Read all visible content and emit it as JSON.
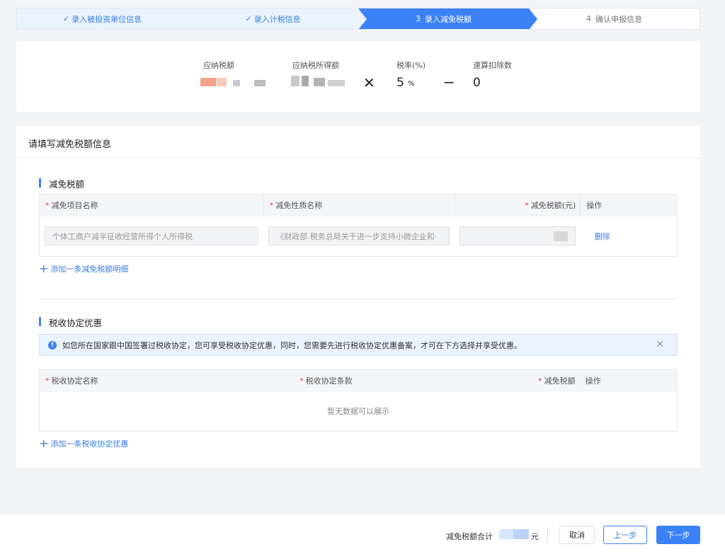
{
  "steps": [
    {
      "label": "录入被投资单位信息",
      "state": "done",
      "check": "✓"
    },
    {
      "label": "录入计税信息",
      "state": "done",
      "check": "✓"
    },
    {
      "num": "3",
      "label": "录入减免税额",
      "state": "active"
    },
    {
      "num": "4",
      "label": "确认申报信息",
      "state": "todo"
    }
  ],
  "formula": {
    "tax_payable_label": "应纳税额",
    "taxable_income_label": "应纳税所得额",
    "rate_label": "税率(%)",
    "rate_value": "5",
    "rate_unit": "%",
    "deduction_label": "速算扣除数",
    "deduction_value": "0",
    "times": "✕",
    "minus": "−"
  },
  "card": {
    "title": "请填写减免税额信息",
    "exemption_section": {
      "title": "减免税额",
      "columns": [
        "减免项目名称",
        "减免性质名称",
        "减免税额(元)",
        "操作"
      ],
      "row": {
        "item_name": "个体工商户减半征收经营所得个人所得税",
        "nature_name": "《财政部 税务总局关于进一步支持小微企业和·",
        "action": "删除"
      },
      "add_label": "添加一条减免税额明细"
    },
    "treaty_section": {
      "title": "税收协定优惠",
      "notice": "如您所在国家跟中国签署过税收协定，您可享受税收协定优惠，同时，您需要先进行税收协定优惠备案，才可在下方选择并享受优惠。",
      "columns": [
        "税收协定名称",
        "税收协定条款",
        "减免税额",
        "操作"
      ],
      "empty": "暂无数据可以展示",
      "add_label": "添加一条税收协定优惠"
    }
  },
  "footer": {
    "sum_label": "减免税额合计",
    "unit": "元",
    "cancel": "取消",
    "prev": "上一步",
    "next": "下一步"
  }
}
